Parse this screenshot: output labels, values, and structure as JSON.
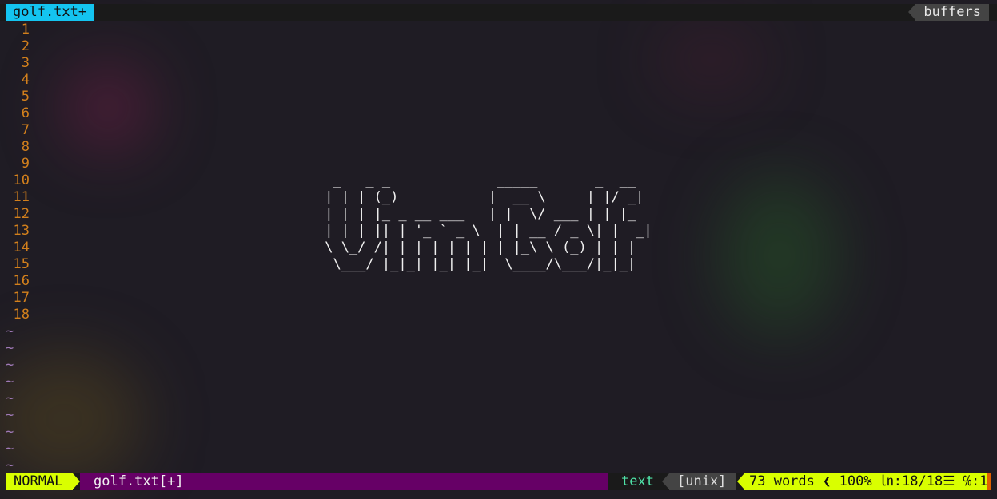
{
  "tabline": {
    "active_tab": "golf.txt+",
    "buffers_label": "buffers"
  },
  "editor": {
    "lines": [
      {
        "n": "1",
        "t": ""
      },
      {
        "n": "2",
        "t": ""
      },
      {
        "n": "3",
        "t": ""
      },
      {
        "n": "4",
        "t": ""
      },
      {
        "n": "5",
        "t": ""
      },
      {
        "n": "6",
        "t": ""
      },
      {
        "n": "7",
        "t": ""
      },
      {
        "n": "8",
        "t": ""
      },
      {
        "n": "9",
        "t": ""
      },
      {
        "n": "10",
        "t": "                                    _   _ _             _____       _  __"
      },
      {
        "n": "11",
        "t": "                                   | | | (_)           |  __ \\     | |/ _|"
      },
      {
        "n": "12",
        "t": "                                   | | | |_ _ __ ___   | |  \\/ ___ | | |_"
      },
      {
        "n": "13",
        "t": "                                   | | | || | '_ ` _ \\  | | __ / _ \\| |  _|"
      },
      {
        "n": "14",
        "t": "                                   \\ \\_/ /| | | | | | | | |_\\ \\ (_) | | |"
      },
      {
        "n": "15",
        "t": "                                    \\___/ |_|_| |_| |_|  \\____/\\___/|_|_|"
      },
      {
        "n": "16",
        "t": ""
      },
      {
        "n": "17",
        "t": ""
      },
      {
        "n": "18",
        "t": ""
      }
    ],
    "tilde": "~"
  },
  "statusline": {
    "mode": "NORMAL",
    "filename": "golf.txt[+]",
    "filetype": "text",
    "fileformat": "[unix]",
    "words": "73 words",
    "percent": "100%",
    "line_info": "㏑:18/18☰",
    "col_info": "℅:1"
  }
}
